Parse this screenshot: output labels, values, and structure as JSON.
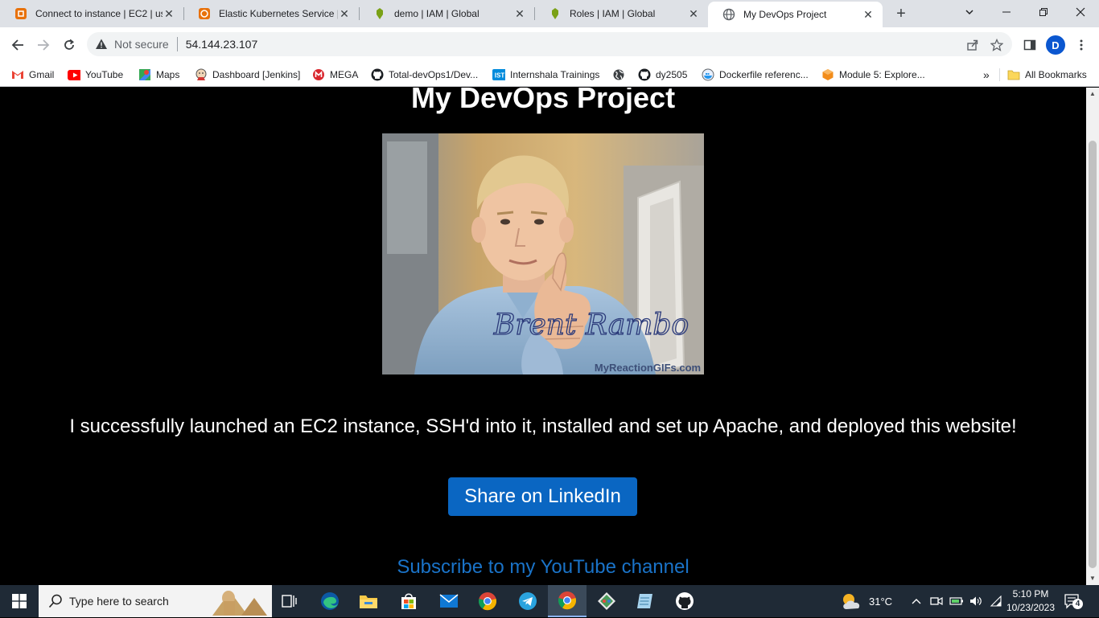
{
  "tabs": [
    {
      "title": "Connect to instance | EC2 | us",
      "icon": "aws-ec2-icon",
      "active": false
    },
    {
      "title": "Elastic Kubernetes Service | us",
      "icon": "aws-eks-icon",
      "active": false
    },
    {
      "title": "demo | IAM | Global",
      "icon": "aws-iam-icon",
      "active": false
    },
    {
      "title": "Roles | IAM | Global",
      "icon": "aws-iam-icon",
      "active": false
    },
    {
      "title": "My DevOps Project",
      "icon": "globe-icon",
      "active": true
    }
  ],
  "toolbar": {
    "security_label": "Not secure",
    "url": "54.144.23.107",
    "profile_initial": "D"
  },
  "bookmarks": [
    {
      "label": "Gmail",
      "icon": "gmail-icon"
    },
    {
      "label": "YouTube",
      "icon": "youtube-icon"
    },
    {
      "label": "Maps",
      "icon": "maps-icon"
    },
    {
      "label": "Dashboard [Jenkins]",
      "icon": "jenkins-icon"
    },
    {
      "label": "MEGA",
      "icon": "mega-icon"
    },
    {
      "label": "Total-devOps1/Dev...",
      "icon": "github-icon"
    },
    {
      "label": "Internshala Trainings",
      "icon": "internshala-icon"
    },
    {
      "label": "",
      "icon": "globe-icon"
    },
    {
      "label": "dy2505",
      "icon": "github-icon"
    },
    {
      "label": "Dockerfile referenc...",
      "icon": "docker-icon"
    },
    {
      "label": "Module 5: Explore...",
      "icon": "module-icon"
    }
  ],
  "bookmarks_overflow": "»",
  "all_bookmarks_label": "All Bookmarks",
  "page": {
    "title": "My DevOps Project",
    "image_caption": "MyReactionGIFs.com",
    "image_signature": "Brent Rambo",
    "message": "I successfully launched an EC2 instance, SSH'd into it, installed and set up Apache, and deployed this website!",
    "linkedin_button": "Share on LinkedIn",
    "youtube_link": "Subscribe to my YouTube channel"
  },
  "taskbar": {
    "search_placeholder": "Type here to search",
    "weather": "31°C",
    "time": "5:10 PM",
    "date": "10/23/2023",
    "notification_count": "4"
  },
  "colors": {
    "linkedin_blue": "#0a66c2",
    "link_blue": "#1a73c8",
    "page_bg": "#000000"
  }
}
